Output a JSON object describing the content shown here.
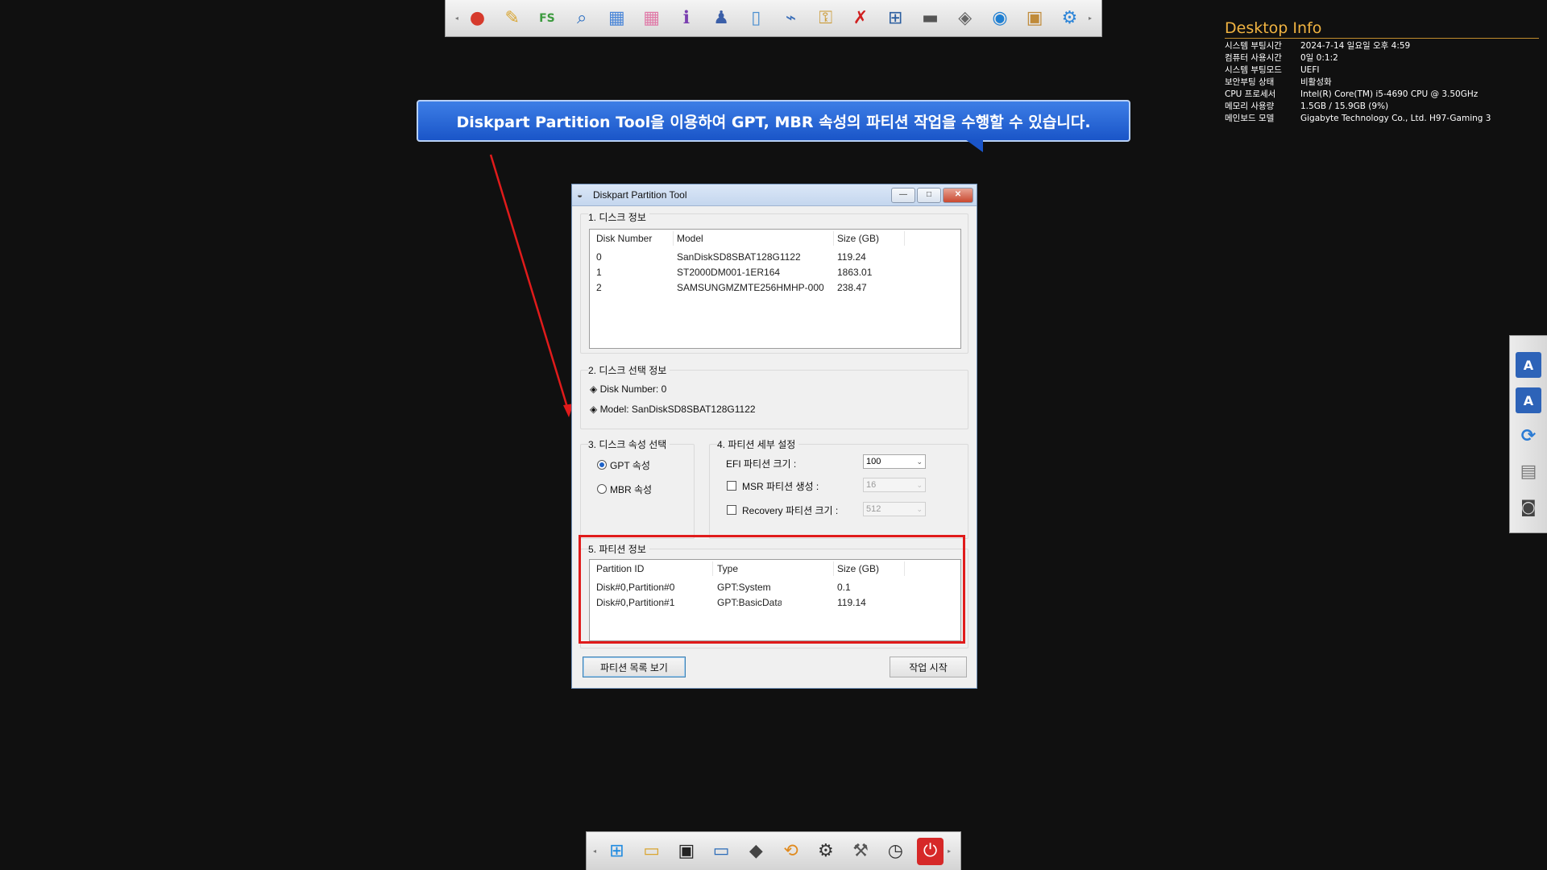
{
  "top_bar": {
    "icons": [
      "disk-tool-icon",
      "folder-tool-icon",
      "fs-tool-icon",
      "search-tool-icon",
      "windows-tile-icon",
      "windows-pink-icon",
      "info-icon",
      "user-icon",
      "device-icon",
      "plug-icon",
      "keys-icon",
      "no-entry-icon",
      "network-icon",
      "drive-icon",
      "tag-icon",
      "globe-icon",
      "box-icon",
      "gears-icon"
    ]
  },
  "banner": {
    "text": "Diskpart Partition Tool을 이용하여 GPT, MBR 속성의 파티션 작업을 수행할 수 있습니다."
  },
  "desktop_info": {
    "title": "Desktop Info",
    "rows": [
      {
        "k": "시스템 부팅시간",
        "v": "2024-7-14 일요일 오후 4:59"
      },
      {
        "k": "컴퓨터 사용시간",
        "v": "0일 0:1:2"
      },
      {
        "k": "시스템 부팅모드",
        "v": "UEFI"
      },
      {
        "k": "보안부팅 상태",
        "v": "비활성화"
      },
      {
        "k": "CPU 프로세서",
        "v": "Intel(R) Core(TM) i5-4690 CPU @ 3.50GHz"
      },
      {
        "k": "메모리 사용량",
        "v": "1.5GB / 15.9GB (9%)"
      },
      {
        "k": "메인보드 모델",
        "v": "Gigabyte Technology Co., Ltd. H97-Gaming 3"
      }
    ]
  },
  "window": {
    "title": "Diskpart Partition Tool",
    "min_glyph": "—",
    "max_glyph": "□",
    "close_glyph": "✕",
    "section1_title": "1. 디스크 정보",
    "disk_headers": [
      "Disk Number",
      "Model",
      "Size (GB)"
    ],
    "disks": [
      {
        "num": "0",
        "model": "SanDiskSD8SBAT128G1122",
        "size": "119.24"
      },
      {
        "num": "1",
        "model": "ST2000DM001-1ER164",
        "size": "1863.01"
      },
      {
        "num": "2",
        "model": "SAMSUNGMZMTE256HMHP-000",
        "size": "238.47"
      }
    ],
    "section2_title": "2. 디스크 선택 정보",
    "selected_disk_number": "◈ Disk Number: 0",
    "selected_disk_model": "◈ Model: SanDiskSD8SBAT128G1122",
    "section3_title": "3. 디스크 속성 선택",
    "gpt_label": "GPT 속성",
    "mbr_label": "MBR 속성",
    "gpt_selected": true,
    "section4_title": "4. 파티션 세부 설정",
    "efi_label": "EFI 파티션 크기 :",
    "efi_value": "100",
    "msr_label": "MSR 파티션 생성 :",
    "msr_value": "16",
    "recovery_label": "Recovery 파티션 크기 :",
    "recovery_value": "512",
    "section5_title": "5. 파티션 정보",
    "partition_headers": [
      "Partition ID",
      "Type",
      "Size (GB)"
    ],
    "partitions": [
      {
        "id": "Disk#0,Partition#0",
        "type": "GPT:System",
        "size": "0.1"
      },
      {
        "id": "Disk#0,Partition#1",
        "type": "GPT:BasicData",
        "size": "119.14"
      }
    ],
    "view_partitions_button": "파티션 목록 보기",
    "start_button": "작업 시작"
  },
  "right_bar": {
    "icons": [
      "font-a-icon",
      "font-a2-icon",
      "refresh-icon",
      "computer-icon",
      "camera-icon"
    ]
  },
  "bottom_bar": {
    "icons": [
      "windows-start-icon",
      "explorer-icon",
      "cmd-icon",
      "monitor-icon",
      "drive-icon",
      "sync-icon",
      "settings-icon",
      "hammer-icon",
      "clock-icon",
      "power-icon"
    ]
  },
  "colors": {
    "highlight": "#e01b1b",
    "banner": "#1a55c8",
    "desktop_info_title": "#f0b341"
  }
}
